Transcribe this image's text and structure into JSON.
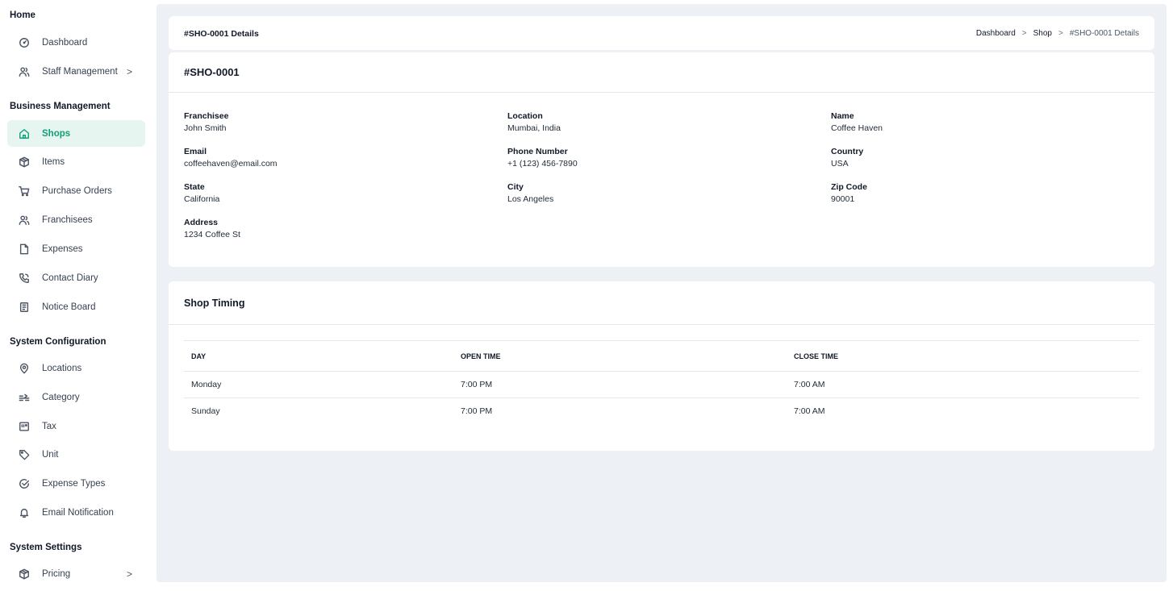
{
  "sidebar": {
    "sections": {
      "home": "Home",
      "business": "Business Management",
      "system_config": "System Configuration",
      "system_settings": "System Settings"
    },
    "items": {
      "dashboard": "Dashboard",
      "staff_management": "Staff Management",
      "shops": "Shops",
      "items": "Items",
      "purchase_orders": "Purchase Orders",
      "franchisees": "Franchisees",
      "expenses": "Expenses",
      "contact_diary": "Contact Diary",
      "notice_board": "Notice Board",
      "locations": "Locations",
      "category": "Category",
      "tax": "Tax",
      "unit": "Unit",
      "expense_types": "Expense Types",
      "email_notification": "Email Notification",
      "pricing": "Pricing"
    },
    "active": "shops",
    "chevron": ">"
  },
  "header": {
    "title": "#SHO-0001 Details",
    "breadcrumb": [
      "Dashboard",
      "Shop",
      "#SHO-0001 Details"
    ],
    "separator": ">"
  },
  "details": {
    "title": "#SHO-0001",
    "fields": {
      "franchisee": {
        "label": "Franchisee",
        "value": "John Smith"
      },
      "location": {
        "label": "Location",
        "value": "Mumbai, India"
      },
      "name": {
        "label": "Name",
        "value": "Coffee Haven"
      },
      "email": {
        "label": "Email",
        "value": "coffeehaven@email.com"
      },
      "phone": {
        "label": "Phone Number",
        "value": "+1 (123) 456-7890"
      },
      "country": {
        "label": "Country",
        "value": "USA"
      },
      "state": {
        "label": "State",
        "value": "California"
      },
      "city": {
        "label": "City",
        "value": "Los Angeles"
      },
      "zip": {
        "label": "Zip Code",
        "value": "90001"
      },
      "address": {
        "label": "Address",
        "value": "1234 Coffee St"
      }
    }
  },
  "timing": {
    "title": "Shop Timing",
    "columns": [
      "DAY",
      "OPEN TIME",
      "CLOSE TIME"
    ],
    "rows": [
      [
        "Monday",
        "7:00 PM",
        "7:00 AM"
      ],
      [
        "Sunday",
        "7:00 PM",
        "7:00 AM"
      ]
    ]
  },
  "colors": {
    "accent": "#0f9f77",
    "active_bg": "#e7f5f0",
    "main_bg": "#edf0f4"
  }
}
